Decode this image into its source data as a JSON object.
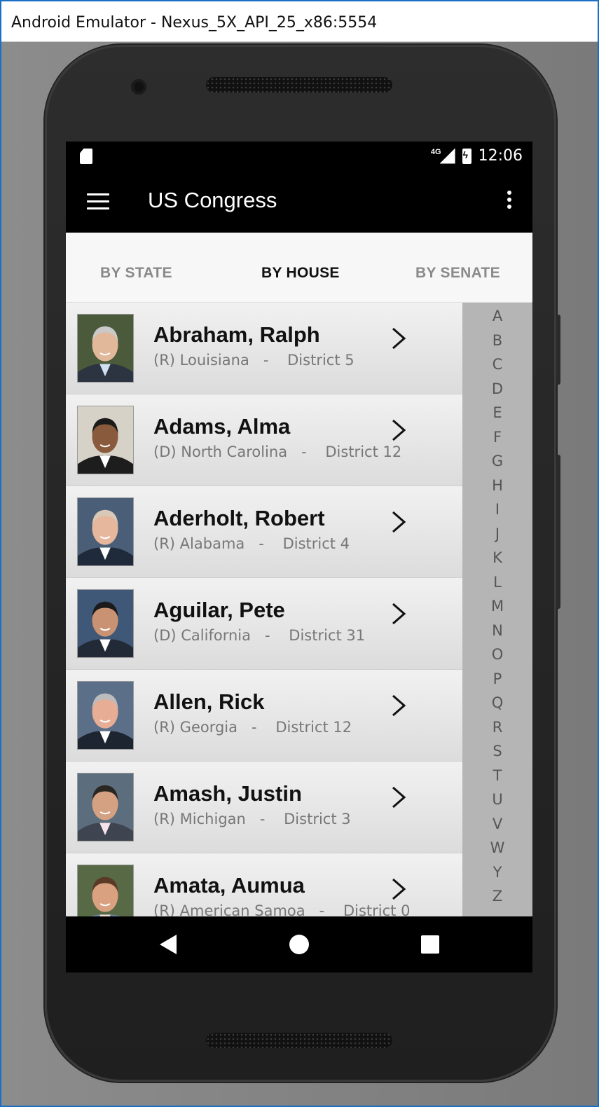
{
  "window": {
    "title": "Android Emulator - Nexus_5X_API_25_x86:5554"
  },
  "status_bar": {
    "network": "4G",
    "time": "12:06"
  },
  "app_bar": {
    "title": "US Congress"
  },
  "tabs": [
    {
      "label": "BY STATE",
      "active": false
    },
    {
      "label": "BY HOUSE",
      "active": true
    },
    {
      "label": "BY SENATE",
      "active": false
    }
  ],
  "members": [
    {
      "name": "Abraham, Ralph",
      "party": "(R)",
      "state": "Louisiana",
      "district": "District 5"
    },
    {
      "name": "Adams, Alma",
      "party": "(D)",
      "state": "North Carolina",
      "district": "District 12"
    },
    {
      "name": "Aderholt, Robert",
      "party": "(R)",
      "state": "Alabama",
      "district": "District 4"
    },
    {
      "name": "Aguilar, Pete",
      "party": "(D)",
      "state": "California",
      "district": "District 31"
    },
    {
      "name": "Allen, Rick",
      "party": "(R)",
      "state": "Georgia",
      "district": "District 12"
    },
    {
      "name": "Amash, Justin",
      "party": "(R)",
      "state": "Michigan",
      "district": "District 3"
    },
    {
      "name": "Amata, Aumua",
      "party": "(R)",
      "state": "American Samoa",
      "district": "District 0"
    }
  ],
  "alphabet_index": [
    "A",
    "B",
    "C",
    "D",
    "E",
    "F",
    "G",
    "H",
    "I",
    "J",
    "K",
    "L",
    "M",
    "N",
    "O",
    "P",
    "Q",
    "R",
    "S",
    "T",
    "U",
    "V",
    "W",
    "Y",
    "Z"
  ],
  "colors": {
    "app_bar": "#000000",
    "tab_active": "#111111",
    "tab_inactive": "#8a8a8a",
    "index_bar": "#b5b5b5"
  },
  "icons": {
    "menu": "hamburger-icon",
    "overflow": "more-vert-icon",
    "row_action": "chevron-right-icon",
    "nav_back": "back-triangle-icon",
    "nav_home": "home-circle-icon",
    "nav_recents": "recents-square-icon"
  }
}
